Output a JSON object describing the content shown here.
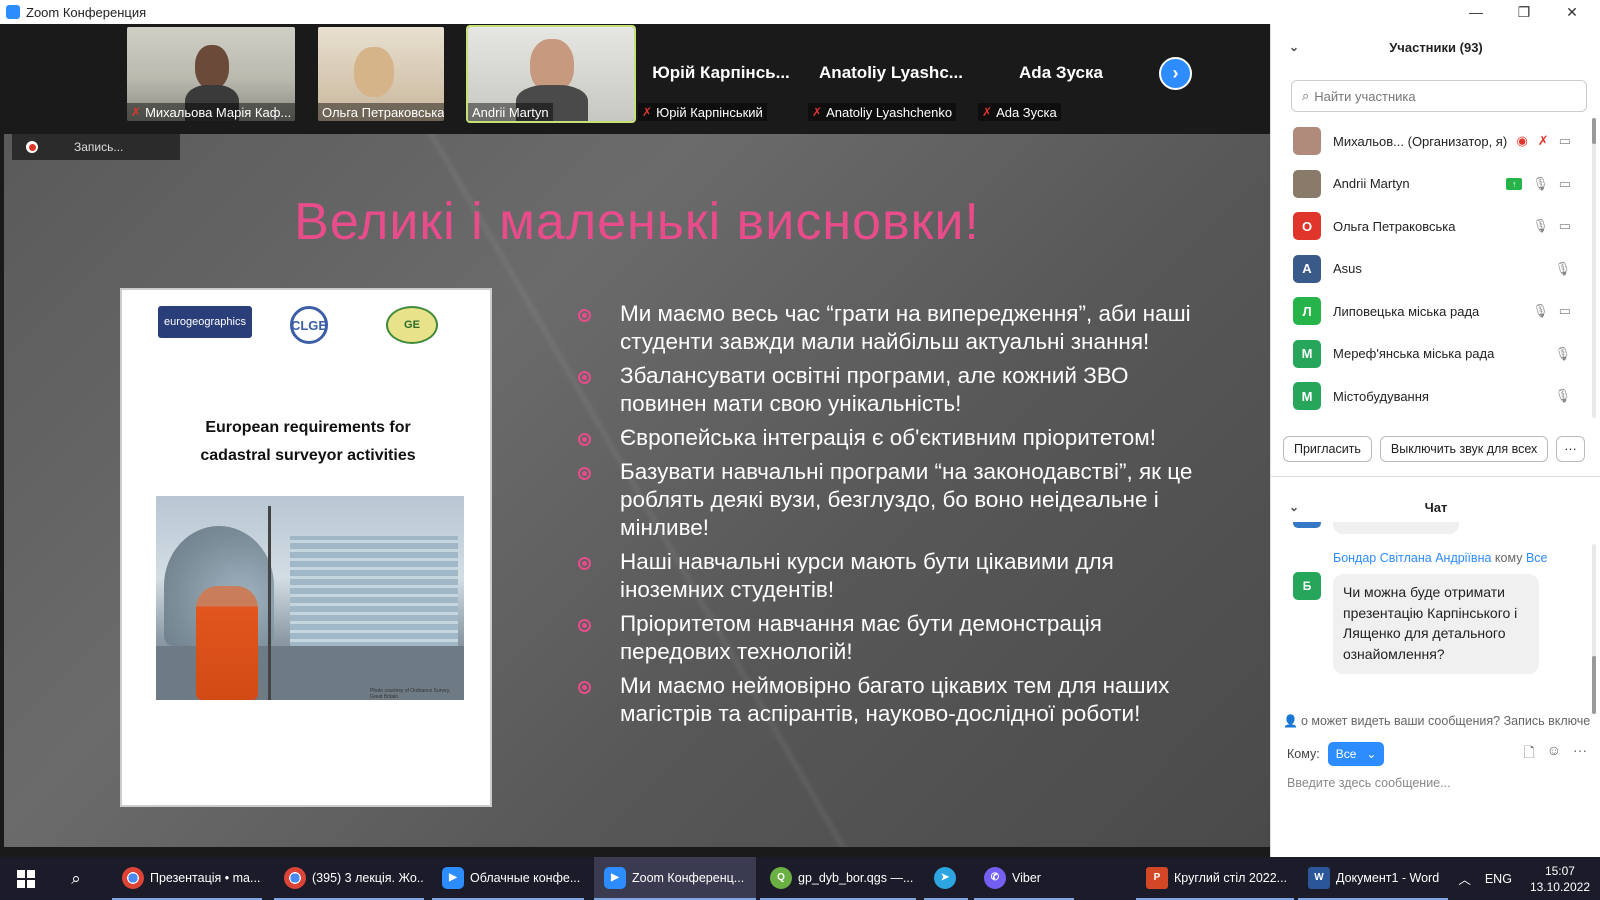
{
  "window": {
    "title": "Zoom Конференция",
    "min": "—",
    "max": "❐",
    "close": "✕"
  },
  "tiles": [
    {
      "name": "Михальова Марія Каф...",
      "muted": true
    },
    {
      "name": "Ольга Петраковська",
      "muted": false
    },
    {
      "name": "Andrii Martyn",
      "muted": false
    },
    {
      "big": "Юрій Карпінсь...",
      "name": "Юрій Карпінський",
      "muted": true
    },
    {
      "big": "Anatoliy  Lyashc...",
      "name": "Anatoliy Lyashchenko",
      "muted": true
    },
    {
      "big": "Ada Зуска",
      "name": "Ada Зуска",
      "muted": true
    }
  ],
  "next_label": "›",
  "recording": {
    "label": "Запись..."
  },
  "slide": {
    "title": "Великі і маленькі висновки!",
    "doc": {
      "logo1": "eurogeographics",
      "logo2": "CLGE",
      "logo3": "GE",
      "title_line1": "European requirements for",
      "title_line2": "cadastral surveyor activities",
      "photo_caption": "Photo courtesy of Ordnance Survey, Great Britain"
    },
    "bullets": [
      "Ми маємо весь час “грати на випередження”, аби наші студенти завжди мали найбільш актуальні знання!",
      "Збалансувати освітні програми, але кожний ЗВО повинен мати свою унікальність!",
      "Європейська інтеграція є об'єктивним пріоритетом!",
      "Базувати навчальні програми “на законодавстві”, як це роблять деякі вузи, безглуздо, бо воно неідеальне і мінливе!",
      "Наші навчальні курси мають бути цікавими для іноземних студентів!",
      "Пріоритетом навчання має бути демонстрація передових технологій!",
      "Ми маємо неймовірно багато цікавих тем для наших магістрів та аспірантів, науково-дослідної роботи!"
    ]
  },
  "participants": {
    "header": "Участники (93)",
    "search_placeholder": "Найти участника",
    "list": [
      {
        "name": "Михальов...  (Организатор, я)",
        "initial": "",
        "color": "#b08a7a",
        "icons": [
          "●",
          "🎤̸",
          "▭"
        ]
      },
      {
        "name": "Andrii Martyn",
        "initial": "",
        "color": "#8a7a6a",
        "icons": [
          "🎤",
          "▭"
        ]
      },
      {
        "name": "Ольга Петраковська",
        "initial": "О",
        "color": "#e0352b",
        "icons": [
          "🎤",
          "▭"
        ]
      },
      {
        "name": "Asus",
        "initial": "A",
        "color": "#3a5a8a",
        "icons": [
          "🎤"
        ]
      },
      {
        "name": "Липовецька міська рада",
        "initial": "Л",
        "color": "#26b34a",
        "icons": [
          "🎤",
          "▭"
        ]
      },
      {
        "name": "Мереф'янська міська рада",
        "initial": "M",
        "color": "#26a65b",
        "icons": [
          "🎤"
        ]
      },
      {
        "name": "Містобудування",
        "initial": "M",
        "color": "#26a65b",
        "icons": [
          "🎤"
        ]
      }
    ],
    "invite": "Пригласить",
    "mute_all": "Выключить звук для всех",
    "more": "···"
  },
  "chat": {
    "header": "Чат",
    "sender": "Бондар Світлана Андріївна",
    "to_word": "кому",
    "to_target": "Все",
    "avatar_initial": "Б",
    "message": "Чи можна буде отримати презентацію Карпінського і Лященко для детального ознайомлення?",
    "notice": "о может видеть ваши сообщения? Запись включе",
    "to_label": "Кому:",
    "to_value": "Все",
    "input_placeholder": "Введите здесь сообщение..."
  },
  "taskbar": {
    "items": [
      {
        "label": "Презентація • ma...",
        "icon": "chrome-icon"
      },
      {
        "label": "(395) 3 лекція. Жо...",
        "icon": "chrome-icon"
      },
      {
        "label": "Облачные конфе...",
        "icon": "zoom-icon"
      },
      {
        "label": "Zoom Конференц...",
        "icon": "zoom-icon"
      },
      {
        "label": "gp_dyb_bor.qgs —...",
        "icon": "qgis-icon"
      },
      {
        "label": "",
        "icon": "telegram-icon"
      },
      {
        "label": "Viber",
        "icon": "viber-icon"
      },
      {
        "label": "Круглий стіл 2022...",
        "icon": "powerpoint-icon"
      },
      {
        "label": "Документ1 - Word",
        "icon": "word-icon"
      }
    ],
    "lang": "ENG",
    "time": "15:07",
    "date": "13.10.2022"
  }
}
